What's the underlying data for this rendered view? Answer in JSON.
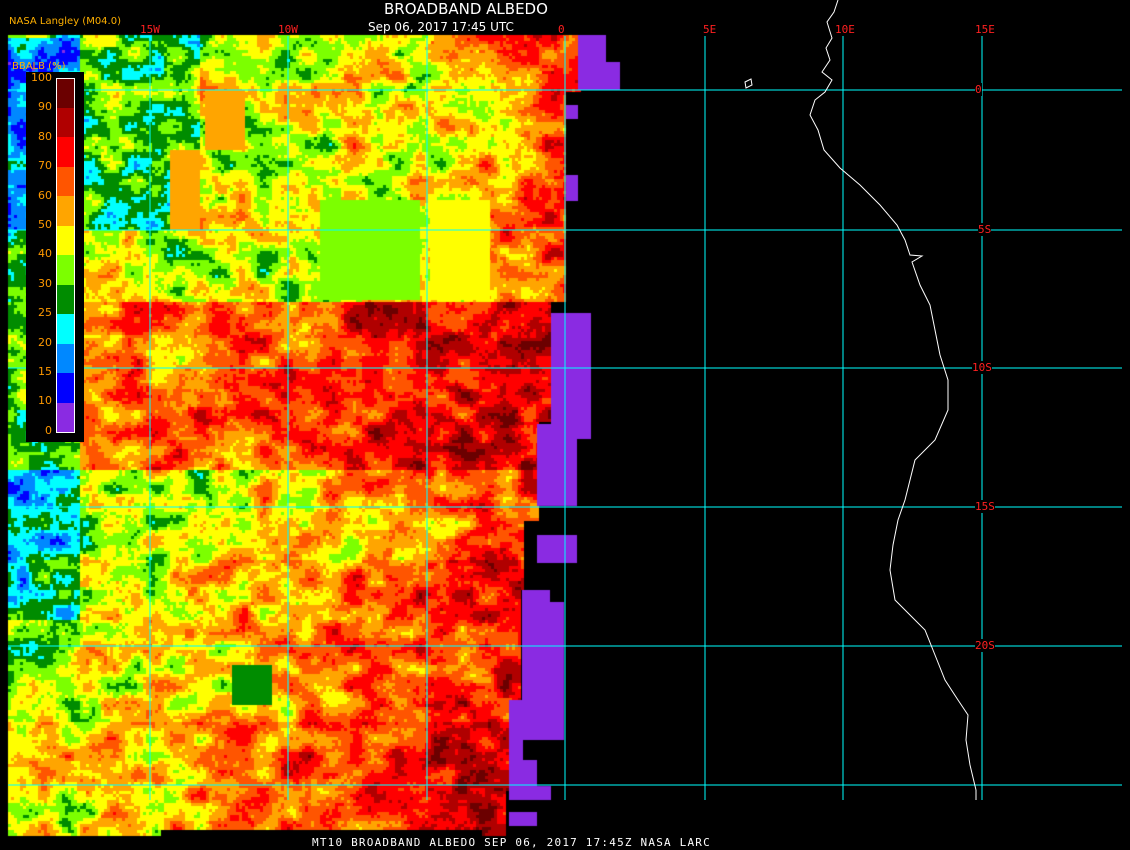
{
  "title": "BROADBAND ALBEDO",
  "datetime": "Sep 06, 2017 17:45 UTC",
  "credit": "NASA Langley (M04.0)",
  "footer": "MT10  BROADBAND ALBEDO   SEP 06, 2017 17:45Z   NASA LARC",
  "legend": {
    "title": "BBALB (%)",
    "ticks": [
      "100",
      "90",
      "80",
      "70",
      "60",
      "50",
      "40",
      "30",
      "25",
      "20",
      "15",
      "10",
      "0"
    ],
    "colors": [
      "#6b0000",
      "#b00000",
      "#ff0000",
      "#ff5500",
      "#ffa500",
      "#ffff00",
      "#7cff00",
      "#008c00",
      "#00ffff",
      "#0088ff",
      "#0000ff",
      "#8a2be2"
    ]
  },
  "map": {
    "lon_labels": [
      "15W",
      "10W",
      "0",
      "5E",
      "10E",
      "15E"
    ],
    "lat_labels": [
      "0",
      "5S",
      "10S",
      "15S",
      "20S"
    ],
    "grid_color": "#00ffff",
    "label_color": "#ff2020",
    "coast_color": "#ffffff"
  }
}
